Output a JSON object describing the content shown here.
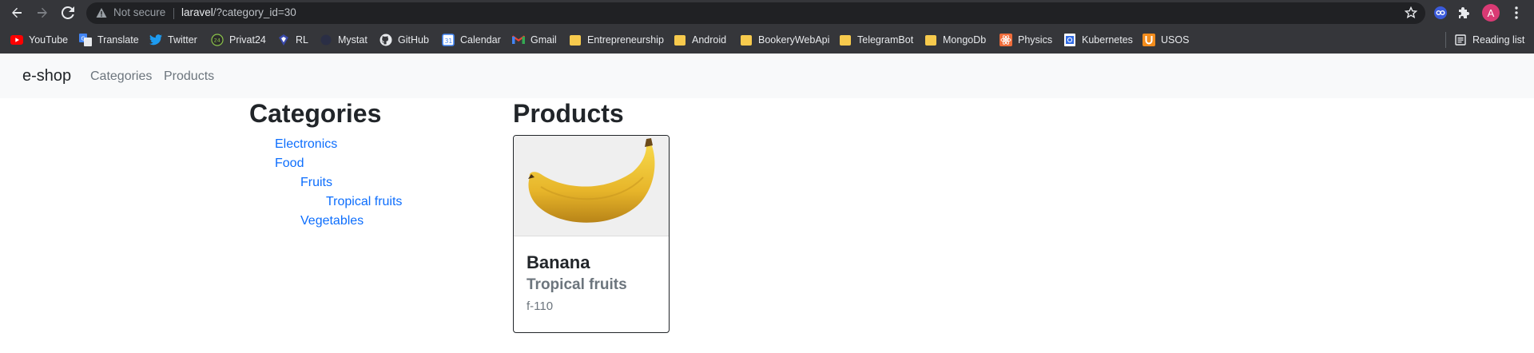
{
  "browser": {
    "security_label": "Not secure",
    "url_host": "laravel",
    "url_path": "/?category_id=30",
    "avatar_letter": "A",
    "icons": [
      "back-icon",
      "forward-icon",
      "reload-icon",
      "warning-icon",
      "star-icon",
      "extension-icon",
      "puzzle-icon",
      "menu-icon"
    ]
  },
  "bookmarks": [
    {
      "label": "YouTube",
      "icon": "youtube-icon"
    },
    {
      "label": "Translate",
      "icon": "translate-icon"
    },
    {
      "label": "Twitter",
      "icon": "twitter-icon"
    },
    {
      "label": "Privat24",
      "icon": "privat24-icon"
    },
    {
      "label": "RL",
      "icon": "rl-icon"
    },
    {
      "label": "Mystat",
      "icon": "mystat-icon"
    },
    {
      "label": "GitHub",
      "icon": "github-icon"
    },
    {
      "label": "Calendar",
      "icon": "calendar-icon"
    },
    {
      "label": "Gmail",
      "icon": "gmail-icon"
    },
    {
      "label": "Entrepreneurship",
      "icon": "folder-icon"
    },
    {
      "label": "Android",
      "icon": "folder-icon"
    },
    {
      "label": "BookeryWebApi",
      "icon": "folder-icon"
    },
    {
      "label": "TelegramBot",
      "icon": "folder-icon"
    },
    {
      "label": "MongoDb",
      "icon": "folder-icon"
    },
    {
      "label": "Physics",
      "icon": "physics-icon"
    },
    {
      "label": "Kubernetes",
      "icon": "kubernetes-icon"
    },
    {
      "label": "USOS",
      "icon": "usos-icon"
    }
  ],
  "reading_list": "Reading list",
  "site": {
    "brand": "e-shop",
    "nav": [
      "Categories",
      "Products"
    ]
  },
  "categories": {
    "heading": "Categories",
    "items": [
      {
        "label": "Electronics",
        "level": 0
      },
      {
        "label": "Food",
        "level": 0
      },
      {
        "label": "Fruits",
        "level": 1
      },
      {
        "label": "Tropical fruits",
        "level": 2
      },
      {
        "label": "Vegetables",
        "level": 1
      }
    ]
  },
  "products": {
    "heading": "Products",
    "items": [
      {
        "title": "Banana",
        "category": "Tropical fruits",
        "sku": "f-110"
      }
    ]
  },
  "colors": {
    "link": "#0d6efd",
    "chrome_bg": "#35363a",
    "navbar_bg": "#f8f9fa"
  }
}
